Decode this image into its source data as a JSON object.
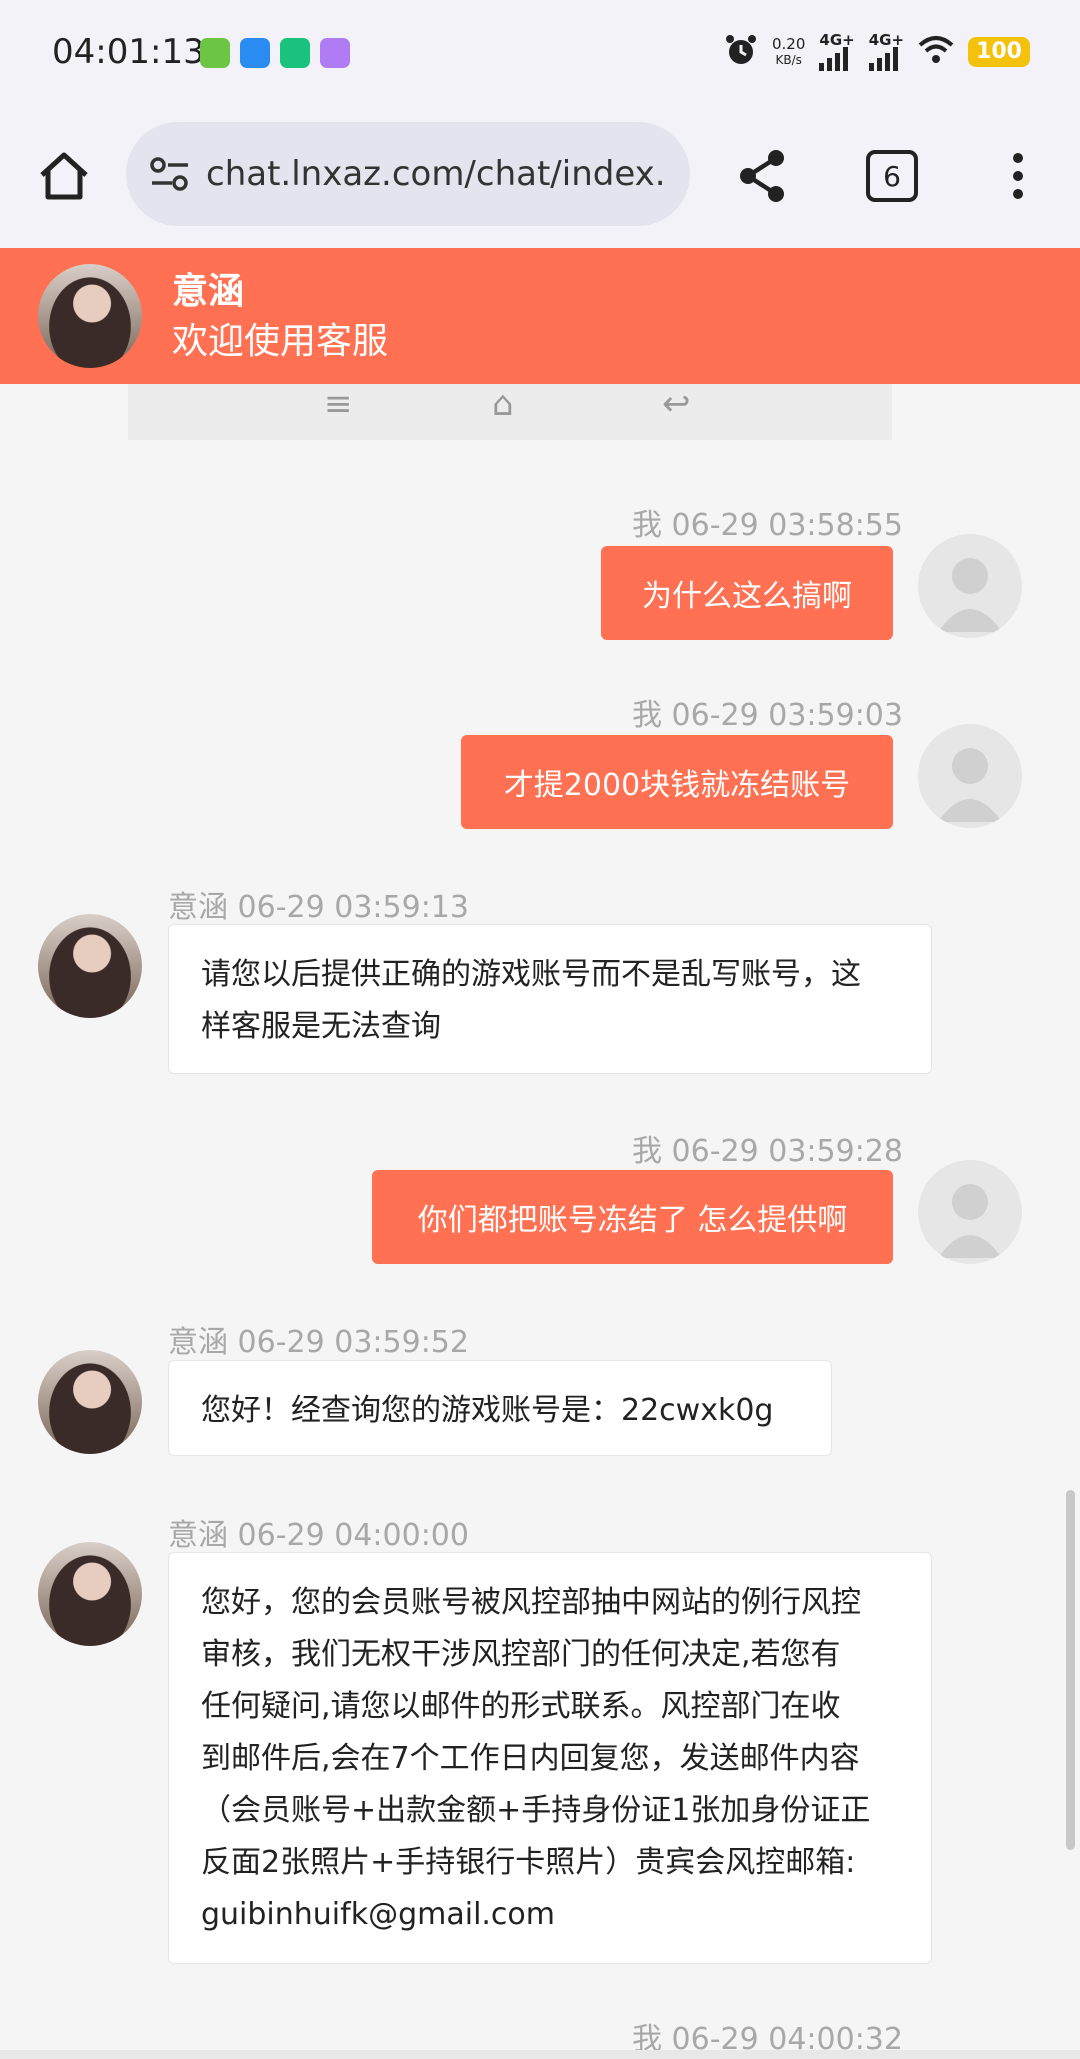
{
  "status_bar": {
    "time": "04:01:13",
    "net_speed_value": "0.20",
    "net_speed_unit": "KB/s",
    "signal1_label": "4G+",
    "signal2_label": "4G+",
    "battery": "100",
    "app_icon_colors": [
      "#6cc644",
      "#2a8cf0",
      "#19c37d",
      "#b07cf4"
    ]
  },
  "browser": {
    "url": "chat.lnxaz.com/chat/index.htm",
    "tab_count": "6"
  },
  "chat_header": {
    "agent_name": "意涵",
    "subtitle": "欢迎使用客服"
  },
  "colors": {
    "accent": "#ff7152",
    "timestamp": "#a8a8a8"
  },
  "messages": [
    {
      "sender": "me",
      "meta": "我 06-29 03:58:55",
      "text": "为什么这么搞啊"
    },
    {
      "sender": "me",
      "meta": "我 06-29 03:59:03",
      "text": "才提2000块钱就冻结账号"
    },
    {
      "sender": "agent",
      "meta": "意涵  06-29 03:59:13",
      "lines": [
        "请您以后提供正确的游戏账号而不是乱写账号，这",
        "样客服是无法查询"
      ]
    },
    {
      "sender": "me",
      "meta": "我 06-29 03:59:28",
      "text": "你们都把账号冻结了 怎么提供啊"
    },
    {
      "sender": "agent",
      "meta": "意涵  06-29 03:59:52",
      "lines": [
        "您好！经查询您的游戏账号是：22cwxk0g"
      ]
    },
    {
      "sender": "agent",
      "meta": "意涵  06-29 04:00:00",
      "lines": [
        "您好，您的会员账号被风控部抽中网站的例行风控",
        "审核，我们无权干涉风控部门的任何决定,若您有",
        "任何疑问,请您以邮件的形式联系。风控部门在收",
        "到邮件后,会在7个工作日内回复您，发送邮件内容",
        "（会员账号+出款金额+手持身份证1张加身份证正",
        "反面2张照片+手持银行卡照片）贵宾会风控邮箱:",
        "guibinhuifk@gmail.com"
      ]
    },
    {
      "sender": "me",
      "meta": "我 06-29 04:00:32"
    }
  ]
}
